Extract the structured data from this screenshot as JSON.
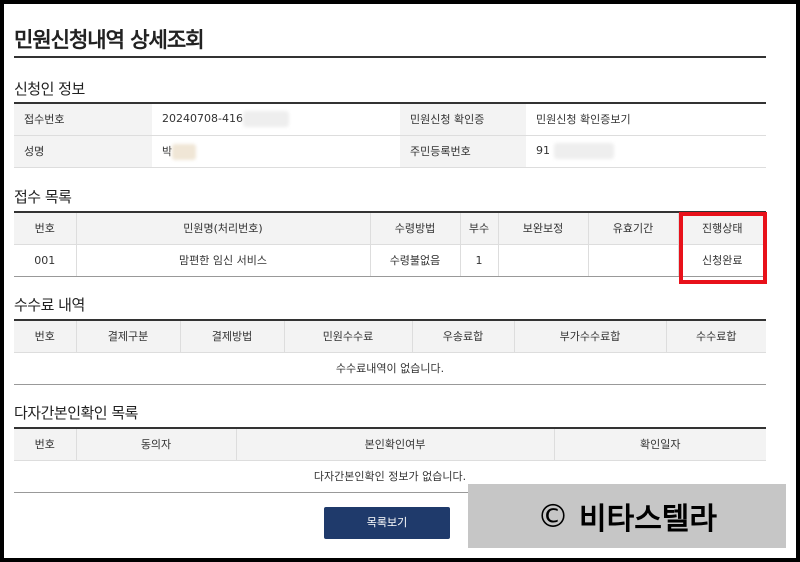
{
  "page_title": "민원신청내역 상세조회",
  "applicant": {
    "section_title": "신청인 정보",
    "receipt_no_label": "접수번호",
    "receipt_no_value": "20240708-416",
    "confirm_label": "민원신청 확인증",
    "confirm_link": "민원신청 확인증보기",
    "name_label": "성명",
    "name_value": "박",
    "rrn_label": "주민등록번호",
    "rrn_value": "91"
  },
  "receipt_list": {
    "section_title": "접수 목록",
    "headers": [
      "번호",
      "민원명(처리번호)",
      "수령방법",
      "부수",
      "보완보정",
      "유효기간",
      "진행상태"
    ],
    "rows": [
      [
        "001",
        "맘편한 임신 서비스",
        "수령불없음",
        "1",
        "",
        "",
        "신청완료"
      ]
    ]
  },
  "fee_list": {
    "section_title": "수수료 내역",
    "headers": [
      "번호",
      "결제구분",
      "결제방법",
      "민원수수료",
      "우송료합",
      "부가수수료합",
      "수수료합"
    ],
    "empty_message": "수수료내역이 없습니다."
  },
  "identity_list": {
    "section_title": "다자간본인확인 목록",
    "headers": [
      "번호",
      "동의자",
      "본인확인여부",
      "확인일자"
    ],
    "empty_message": "다자간본인확인 정보가 없습니다."
  },
  "buttons": {
    "list_label": "목록보기"
  },
  "watermark": {
    "symbol": "©",
    "text": "비타스텔라"
  },
  "colors": {
    "highlight": "#e8111a",
    "button_bg": "#1f3a6b",
    "watermark_bg": "#c6c6c6"
  }
}
